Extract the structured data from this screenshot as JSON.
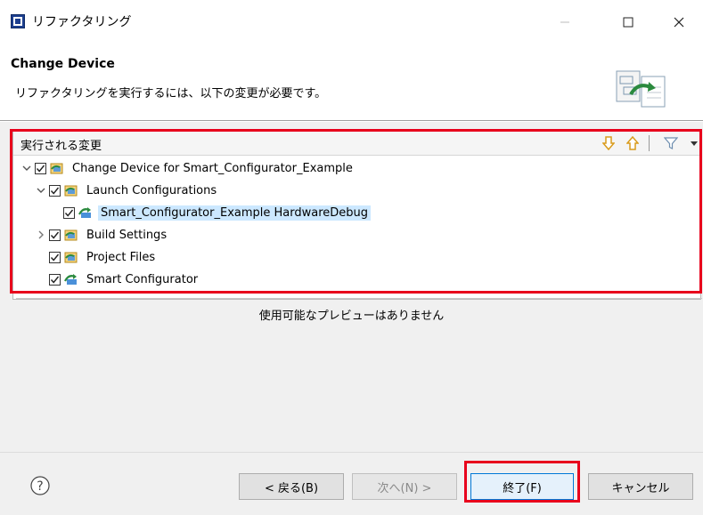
{
  "window": {
    "title": "リファクタリング",
    "icon": "refactor-app-icon"
  },
  "header": {
    "title": "Change Device",
    "message": "リファクタリングを実行するには、以下の変更が必要です。",
    "image": "refactoring-wizard-image"
  },
  "changes": {
    "title": "実行される変更",
    "tree": [
      {
        "label": "Change Device for Smart_Configurator_Example",
        "checked": true,
        "expanded": true,
        "level": 0,
        "icon": "project-change-icon"
      },
      {
        "label": "Launch Configurations",
        "checked": true,
        "expanded": true,
        "level": 1,
        "icon": "launch-config-icon"
      },
      {
        "label": "Smart_Configurator_Example HardwareDebug",
        "checked": true,
        "level": 2,
        "selected": true,
        "icon": "debug-config-icon"
      },
      {
        "label": "Build Settings",
        "checked": true,
        "expanded": false,
        "level": 1,
        "icon": "build-settings-icon"
      },
      {
        "label": "Project Files",
        "checked": true,
        "level": 1,
        "icon": "project-files-icon"
      },
      {
        "label": "Smart Configurator",
        "checked": true,
        "level": 1,
        "icon": "smart-configurator-icon"
      }
    ]
  },
  "preview": {
    "message": "使用可能なプレビューはありません"
  },
  "buttons": {
    "back": "< 戻る(B)",
    "next": "次へ(N) >",
    "finish": "終了(F)",
    "cancel": "キャンセル"
  },
  "colors": {
    "highlight": "#e8001c",
    "selection": "#cce8ff",
    "default_button_border": "#0078d7"
  }
}
